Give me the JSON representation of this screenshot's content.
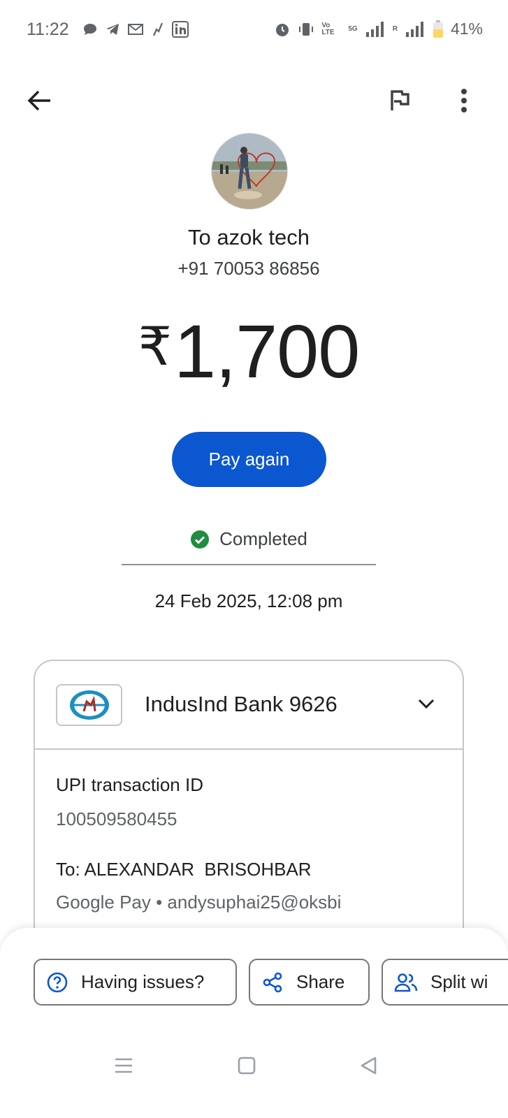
{
  "status_bar": {
    "time": "11:22",
    "network_label": "5G",
    "volte_label": "Vo LTE",
    "roaming_label": "R",
    "battery": "41%",
    "battery_level": 0.41,
    "notification_icons": [
      "chat-icon",
      "telegram-icon",
      "gmail-icon",
      "app-icon",
      "linkedin-icon"
    ]
  },
  "toolbar": {
    "back_icon": "arrow-left-icon",
    "report_icon": "flag-icon",
    "more_icon": "more-vert-icon"
  },
  "recipient": {
    "name": "To azok tech",
    "phone": "+91 70053 86856"
  },
  "payment": {
    "currency_symbol": "₹",
    "amount": "1,700",
    "pay_again_label": "Pay again",
    "status": "Completed",
    "datetime": "24 Feb 2025, 12:08 pm"
  },
  "details": {
    "bank_name": "IndusInd Bank 9626",
    "txn_label": "UPI transaction ID",
    "txn_id": "100509580455",
    "to_label": "To: ALEXANDAR  BRISOHBAR",
    "to_upi": "Google Pay • andysuphai25@oksbi"
  },
  "actions": {
    "issues_label": "Having issues?",
    "share_label": "Share",
    "split_label": "Split wi"
  },
  "colors": {
    "primary": "#0b57d0",
    "success": "#1e8e3e",
    "text": "#1f1f1f",
    "muted": "#5f6368",
    "border": "#c4c7c5"
  }
}
